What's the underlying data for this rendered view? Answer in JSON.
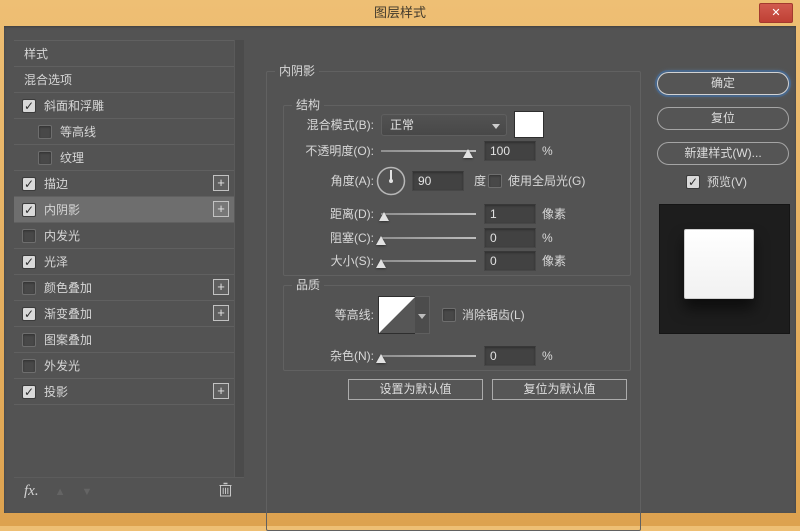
{
  "window": {
    "title": "图层样式",
    "close_glyph": "✕"
  },
  "sidebar": {
    "items": [
      {
        "key": "styles",
        "label": "样式",
        "has_checkbox": false,
        "checked": false,
        "indent": false,
        "plus": false,
        "selected": false
      },
      {
        "key": "blending-options",
        "label": "混合选项",
        "has_checkbox": false,
        "checked": false,
        "indent": false,
        "plus": false,
        "selected": false
      },
      {
        "key": "bevel-and-emboss",
        "label": "斜面和浮雕",
        "has_checkbox": true,
        "checked": true,
        "indent": false,
        "plus": false,
        "selected": false
      },
      {
        "key": "contour",
        "label": "等高线",
        "has_checkbox": true,
        "checked": false,
        "indent": true,
        "plus": false,
        "selected": false
      },
      {
        "key": "texture",
        "label": "纹理",
        "has_checkbox": true,
        "checked": false,
        "indent": true,
        "plus": false,
        "selected": false
      },
      {
        "key": "stroke",
        "label": "描边",
        "has_checkbox": true,
        "checked": true,
        "indent": false,
        "plus": true,
        "selected": false
      },
      {
        "key": "inner-shadow",
        "label": "内阴影",
        "has_checkbox": true,
        "checked": true,
        "indent": false,
        "plus": true,
        "selected": true
      },
      {
        "key": "inner-glow",
        "label": "内发光",
        "has_checkbox": true,
        "checked": false,
        "indent": false,
        "plus": false,
        "selected": false
      },
      {
        "key": "satin",
        "label": "光泽",
        "has_checkbox": true,
        "checked": true,
        "indent": false,
        "plus": false,
        "selected": false
      },
      {
        "key": "color-overlay",
        "label": "颜色叠加",
        "has_checkbox": true,
        "checked": false,
        "indent": false,
        "plus": true,
        "selected": false
      },
      {
        "key": "gradient-overlay",
        "label": "渐变叠加",
        "has_checkbox": true,
        "checked": true,
        "indent": false,
        "plus": true,
        "selected": false
      },
      {
        "key": "pattern-overlay",
        "label": "图案叠加",
        "has_checkbox": true,
        "checked": false,
        "indent": false,
        "plus": false,
        "selected": false
      },
      {
        "key": "outer-glow",
        "label": "外发光",
        "has_checkbox": true,
        "checked": false,
        "indent": false,
        "plus": false,
        "selected": false
      },
      {
        "key": "drop-shadow",
        "label": "投影",
        "has_checkbox": true,
        "checked": true,
        "indent": false,
        "plus": true,
        "selected": false
      }
    ],
    "plus_glyph": "+",
    "footer": {
      "fx_label": "fx.",
      "up_glyph": "▲",
      "down_glyph": "▼"
    }
  },
  "panel": {
    "legend": "内阴影",
    "structure": {
      "legend": "结构",
      "blend_mode": {
        "label": "混合模式(B):",
        "value": "正常"
      },
      "opacity": {
        "label": "不透明度(O):",
        "value": "100",
        "unit": "%"
      },
      "angle": {
        "label": "角度(A):",
        "value": "90",
        "unit": "度",
        "global_light_label": "使用全局光(G)",
        "global_light_checked": false
      },
      "distance": {
        "label": "距离(D):",
        "value": "1",
        "unit": "像素"
      },
      "choke": {
        "label": "阻塞(C):",
        "value": "0",
        "unit": "%"
      },
      "size": {
        "label": "大小(S):",
        "value": "0",
        "unit": "像素"
      }
    },
    "quality": {
      "legend": "品质",
      "contour_label": "等高线:",
      "anti_alias_label": "消除锯齿(L)",
      "anti_alias_checked": false,
      "noise": {
        "label": "杂色(N):",
        "value": "0",
        "unit": "%"
      }
    },
    "buttons": {
      "make_default": "设置为默认值",
      "reset_default": "复位为默认值"
    }
  },
  "actions": {
    "ok": "确定",
    "reset": "复位",
    "new_style": "新建样式(W)...",
    "preview_label": "预览(V)",
    "preview_checked": true
  },
  "colors": {
    "titlebar_orange": "#e6ab5c",
    "close_red": "#c5473c",
    "dialog_gray": "#535353",
    "selected_row": "#6e6e6e",
    "focus_ring_blue": "#48678b",
    "preview_bg": "#1d1d1d"
  }
}
